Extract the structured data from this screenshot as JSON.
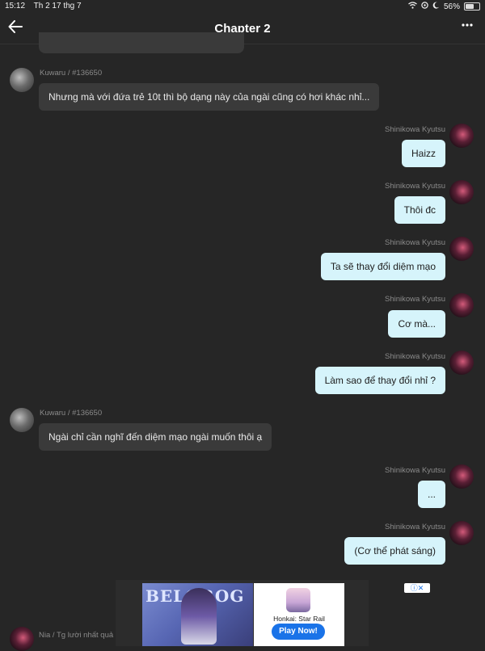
{
  "status_bar": {
    "time": "15:12",
    "date": "Th 2 17 thg 7",
    "battery": "56%",
    "icons": [
      "wifi-icon",
      "location-icon",
      "moon-icon",
      "battery-icon"
    ]
  },
  "header": {
    "title": "Chapter 2",
    "back_icon": "back-arrow-icon",
    "more_icon": "more-options-icon"
  },
  "messages": [
    {
      "side": "left",
      "sender": "Kuwaru / #136650",
      "text": "Nhưng mà với đứa trẻ 10t thì bộ dạng này của ngài cũng có hơi khác nhỉ..."
    },
    {
      "side": "right",
      "sender": "Shinikowa  Kyutsu",
      "text": "Haizz"
    },
    {
      "side": "right",
      "sender": "Shinikowa  Kyutsu",
      "text": "Thôi đc"
    },
    {
      "side": "right",
      "sender": "Shinikowa  Kyutsu",
      "text": "Ta sẽ thay đổi diệm mạo"
    },
    {
      "side": "right",
      "sender": "Shinikowa  Kyutsu",
      "text": "Cơ mà..."
    },
    {
      "side": "right",
      "sender": "Shinikowa  Kyutsu",
      "text": "Làm sao để thay đổi nhỉ ?"
    },
    {
      "side": "left",
      "sender": "Kuwaru / #136650",
      "text": "Ngài chỉ cần nghĩ đến diệm mạo ngài muốn thôi ạ"
    },
    {
      "side": "right",
      "sender": "Shinikowa  Kyutsu",
      "text": "..."
    },
    {
      "side": "right",
      "sender": "Shinikowa  Kyutsu",
      "text": "(Cơ thể phát sáng)"
    }
  ],
  "bottom_sender": "Nia / Tg lười nhất quả đ",
  "ad": {
    "banner_text": "BELOBOG",
    "app_name": "Honkai: Star Rail",
    "cta": "Play Now!",
    "choices_icon": "adchoices-icon"
  },
  "colors": {
    "background": "#262626",
    "left_bubble": "#3a3a3a",
    "right_bubble": "#d6f4fb",
    "cta": "#1a73e8"
  }
}
